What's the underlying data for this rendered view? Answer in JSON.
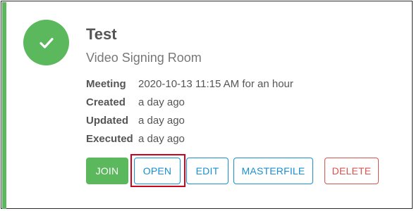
{
  "card": {
    "title": "Test",
    "subtitle": "Video Signing Room",
    "status_icon": "checkmark-icon",
    "accent_color": "#5cb85c"
  },
  "details": [
    {
      "label": "Meeting",
      "value": "2020-10-13 11:15 AM for an hour"
    },
    {
      "label": "Created",
      "value": "a day ago"
    },
    {
      "label": "Updated",
      "value": "a day ago"
    },
    {
      "label": "Executed",
      "value": "a day ago"
    }
  ],
  "actions": {
    "join_label": "JOIN",
    "open_label": "OPEN",
    "edit_label": "EDIT",
    "masterfile_label": "MASTERFILE",
    "delete_label": "DELETE"
  },
  "colors": {
    "success": "#5cb85c",
    "primary": "#1a8fd1",
    "danger": "#d9534f",
    "highlight": "#d0021b"
  }
}
